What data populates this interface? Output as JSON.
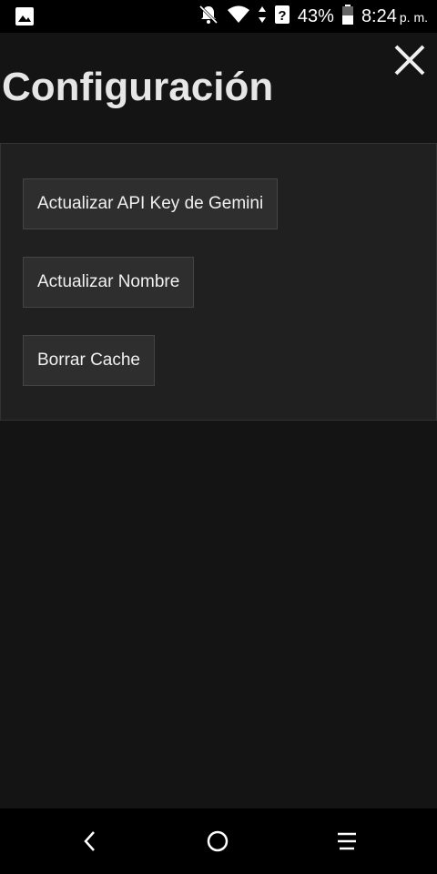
{
  "status_bar": {
    "battery_percent": "43%",
    "time": "8:24",
    "time_suffix": "p. m.",
    "icons": [
      "image-icon",
      "notifications-off-icon",
      "wifi-icon",
      "unknown-network-icon",
      "battery-icon"
    ]
  },
  "header": {
    "title": "Configuración",
    "close_icon": "close-icon"
  },
  "settings": {
    "buttons": [
      {
        "label": "Actualizar API Key de Gemini"
      },
      {
        "label": "Actualizar Nombre"
      },
      {
        "label": "Borrar Cache"
      }
    ]
  },
  "nav_bar": {
    "icons": [
      "back-icon",
      "home-icon",
      "menu-icon"
    ]
  },
  "colors": {
    "background": "#141414",
    "panel": "#202020",
    "button": "#2e2e2e",
    "title_text": "#e6e6e6"
  }
}
